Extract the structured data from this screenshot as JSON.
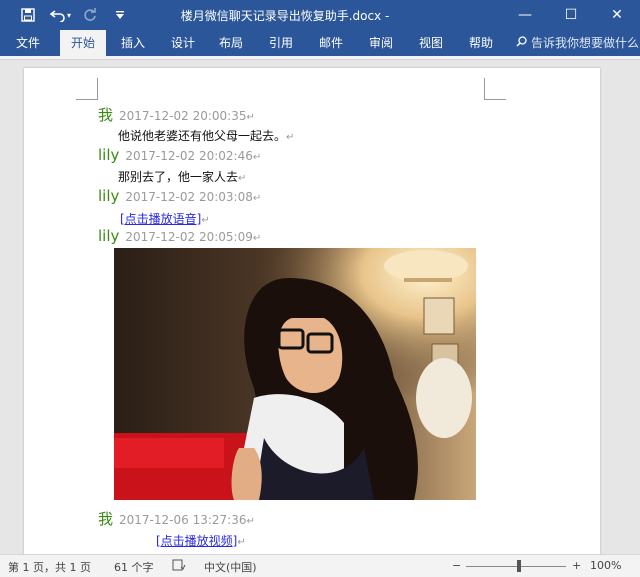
{
  "window": {
    "title": "楼月微信聊天记录导出恢复助手.docx  -",
    "minimize": "—",
    "maximize": "☐",
    "close": "✕"
  },
  "quick_access": {
    "save_icon": "save-icon",
    "undo_icon": "undo-icon",
    "redo_icon": "redo-icon",
    "customize_icon": "customize-icon"
  },
  "ribbon": {
    "tabs": [
      "文件",
      "开始",
      "插入",
      "设计",
      "布局",
      "引用",
      "邮件",
      "审阅",
      "视图",
      "帮助"
    ],
    "active_tab": "开始",
    "tell_me": "告诉我你想要做什么"
  },
  "document": {
    "messages": [
      {
        "sender": "我",
        "time": "2017-12-02 20:00:35",
        "text": "他说他老婆还有他父母一起去。",
        "type": "text"
      },
      {
        "sender": "lily",
        "time": "2017-12-02 20:02:46",
        "text": "那别去了，他一家人去",
        "type": "text"
      },
      {
        "sender": "lily",
        "time": "2017-12-02 20:03:08",
        "text": "[点击播放语音]",
        "type": "voice"
      },
      {
        "sender": "lily",
        "time": "2017-12-02 20:05:09",
        "text": "",
        "type": "image"
      },
      {
        "sender": "我",
        "time": "2017-12-06 13:27:36",
        "text": "[点击播放视频]",
        "type": "video"
      }
    ],
    "paragraph_mark": "↵"
  },
  "status": {
    "page": "第 1 页，共 1 页",
    "words": "61 个字",
    "language": "中文(中国)",
    "zoom_minus": "−",
    "zoom_plus": "+",
    "zoom": "100%"
  },
  "colors": {
    "accent": "#2b579a",
    "sender": "#3a8a14",
    "link": "#2a2ae0"
  }
}
